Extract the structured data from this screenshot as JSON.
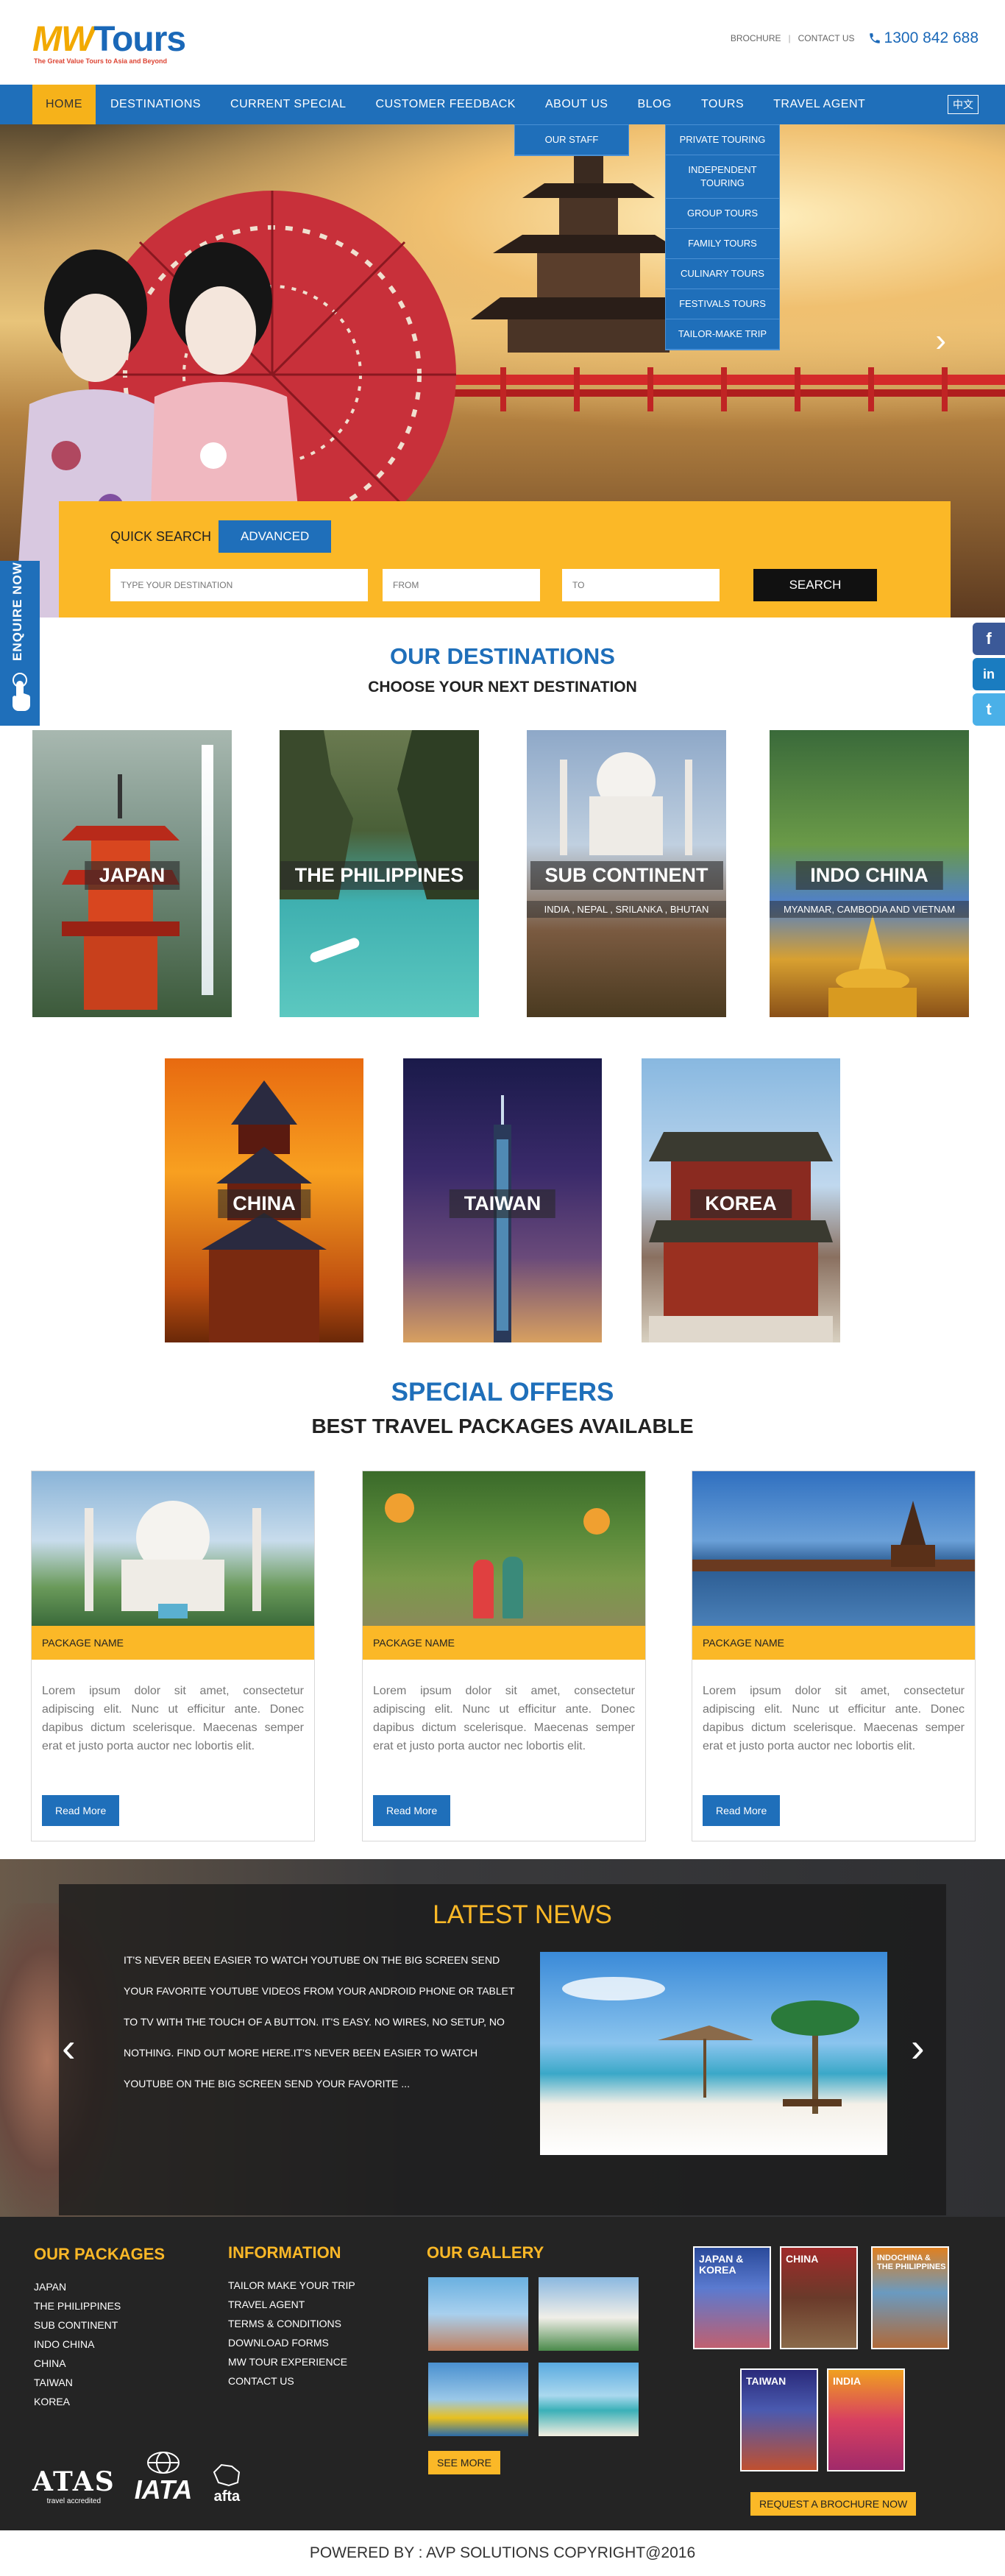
{
  "header": {
    "logo_mw": "MW",
    "logo_tours": "Tours",
    "logo_tagline": "The Great Value Tours to Asia and Beyond",
    "links": [
      "BROCHURE",
      "CONTACT US"
    ],
    "phone": "1300 842 688",
    "icons": [
      "phone-icon"
    ]
  },
  "nav": {
    "items": [
      "HOME",
      "DESTINATIONS",
      "CURRENT SPECIAL",
      "CUSTOMER FEEDBACK",
      "ABOUT US",
      "BLOG",
      "TOURS",
      "TRAVEL AGENT"
    ],
    "active": "HOME",
    "language": "中文"
  },
  "about_menu": [
    "OUR STAFF"
  ],
  "tours_menu": [
    "PRIVATE TOURING",
    "INDEPENDENT TOURING",
    "GROUP TOURS",
    "FAMILY TOURS",
    "CULINARY TOURS",
    "FESTIVALS TOURS",
    "TAILOR-MAKE TRIP"
  ],
  "hero": {
    "next_arrow": "›"
  },
  "quick_search": {
    "label": "QUICK SEARCH",
    "advanced_tab": "ADVANCED",
    "destination_placeholder": "TYPE YOUR DESTINATION",
    "from_placeholder": "FROM",
    "to_placeholder": "TO",
    "search_button": "SEARCH"
  },
  "enquire": {
    "label": "ENQUIRE NOW"
  },
  "social": [
    "f",
    "in",
    "t"
  ],
  "destinations": {
    "title": "OUR DESTINATIONS",
    "subtitle": "CHOOSE YOUR NEXT DESTINATION",
    "items": [
      {
        "name": "JAPAN",
        "sub": ""
      },
      {
        "name": "THE PHILIPPINES",
        "sub": ""
      },
      {
        "name": "SUB CONTINENT",
        "sub": "INDIA , NEPAL , SRILANKA , BHUTAN"
      },
      {
        "name": "INDO CHINA",
        "sub": "MYANMAR, CAMBODIA AND VIETNAM"
      },
      {
        "name": "CHINA",
        "sub": ""
      },
      {
        "name": "TAIWAN",
        "sub": ""
      },
      {
        "name": "KOREA",
        "sub": ""
      }
    ]
  },
  "offers": {
    "title": "SPECIAL OFFERS",
    "subtitle": "BEST TRAVEL PACKAGES AVAILABLE",
    "items": [
      {
        "name": "PACKAGE NAME",
        "text": "Lorem ipsum dolor sit amet, consectetur adipiscing elit. Nunc ut efficitur ante. Donec dapibus dictum scelerisque. Maecenas semper erat et justo porta auctor nec lobortis elit.",
        "button": "Read More"
      },
      {
        "name": "PACKAGE NAME",
        "text": "Lorem ipsum dolor sit amet, consectetur adipiscing elit. Nunc ut efficitur ante. Donec dapibus dictum scelerisque. Maecenas semper erat et justo porta auctor nec lobortis elit.",
        "button": "Read More"
      },
      {
        "name": "PACKAGE NAME",
        "text": "Lorem ipsum dolor sit amet, consectetur adipiscing elit. Nunc ut efficitur ante. Donec dapibus dictum scelerisque. Maecenas semper erat et justo porta auctor nec lobortis elit.",
        "button": "Read More"
      }
    ]
  },
  "news": {
    "title": "LATEST NEWS",
    "text": "IT'S NEVER BEEN EASIER TO WATCH YOUTUBE ON THE BIG SCREEN SEND YOUR FAVORITE YOUTUBE VIDEOS FROM YOUR ANDROID PHONE OR TABLET TO TV WITH THE TOUCH OF A BUTTON. IT'S EASY. NO WIRES, NO SETUP, NO NOTHING. FIND OUT MORE HERE.IT'S NEVER BEEN EASIER TO WATCH YOUTUBE ON THE BIG SCREEN SEND YOUR FAVORITE ...",
    "prev": "‹",
    "next": "›"
  },
  "footer": {
    "packages_title": "OUR PACKAGES",
    "packages": [
      "JAPAN",
      "THE PHILIPPINES",
      "SUB CONTINENT",
      "INDO CHINA",
      "CHINA",
      "TAIWAN",
      "KOREA"
    ],
    "info_title": "INFORMATION",
    "info": [
      "TAILOR MAKE YOUR TRIP",
      "TRAVEL AGENT",
      "TERMS & CONDITIONS",
      "DOWNLOAD FORMS",
      "MW TOUR EXPERIENCE",
      "CONTACT US"
    ],
    "gallery_title": "OUR GALLERY",
    "see_more": "SEE MORE",
    "brochures": [
      "JAPAN & KOREA",
      "CHINA",
      "INDOCHINA & THE PHILIPPINES",
      "TAIWAN",
      "INDIA"
    ],
    "brochure_button": "REQUEST A BROCHURE NOW",
    "logos": [
      "ATAS",
      "IATA",
      "afta"
    ],
    "atas_caption": "travel accredited"
  },
  "copyright": "POWERED BY : AVP SOLUTIONS COPYRIGHT@2016"
}
